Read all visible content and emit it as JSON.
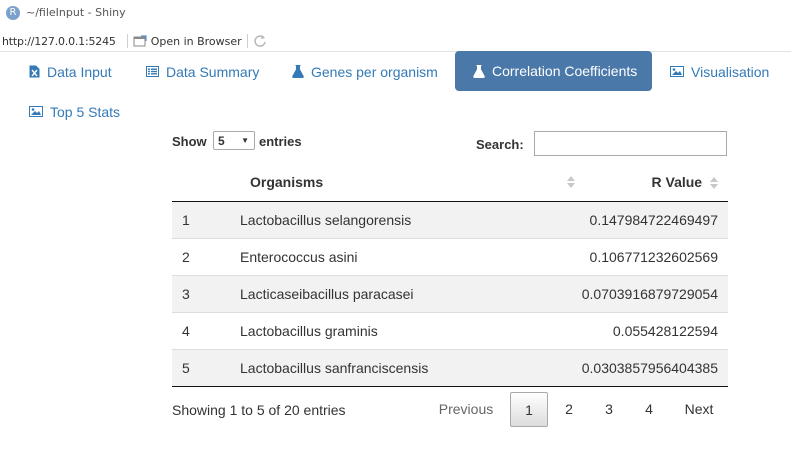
{
  "window": {
    "title": "~/fileInput - Shiny",
    "app_icon": "R"
  },
  "toolbar": {
    "url": "http://127.0.0.1:5245",
    "open_browser_label": "Open in Browser"
  },
  "tabs": [
    {
      "label": "Data Input",
      "icon": "file-excel-icon",
      "active": false
    },
    {
      "label": "Data Summary",
      "icon": "list-alt-icon",
      "active": false
    },
    {
      "label": "Genes per organism",
      "icon": "flask-icon",
      "active": false
    },
    {
      "label": "Correlation Coefficients",
      "icon": "flask-icon",
      "active": true
    },
    {
      "label": "Visualisation",
      "icon": "picture-icon",
      "active": false
    },
    {
      "label": "Top 5 Stats",
      "icon": "picture-icon",
      "active": false
    }
  ],
  "datatable": {
    "length_label_pre": "Show",
    "length_value": "5",
    "length_label_post": "entries",
    "search_label": "Search:",
    "search_value": "",
    "columns": [
      "",
      "Organisms",
      "R Value"
    ],
    "rows": [
      {
        "index": "1",
        "organism": "Lactobacillus selangorensis",
        "r_value": "0.147984722469497"
      },
      {
        "index": "2",
        "organism": "Enterococcus asini",
        "r_value": "0.106771232602569"
      },
      {
        "index": "3",
        "organism": "Lacticaseibacillus paracasei",
        "r_value": "0.0703916879729054"
      },
      {
        "index": "4",
        "organism": "Lactobacillus graminis",
        "r_value": "0.055428122594"
      },
      {
        "index": "5",
        "organism": "Lactobacillus sanfranciscensis",
        "r_value": "0.0303857956404385"
      }
    ],
    "info": "Showing 1 to 5 of 20 entries",
    "pagination": {
      "previous": "Previous",
      "pages": [
        "1",
        "2",
        "3",
        "4"
      ],
      "current": "1",
      "next": "Next"
    }
  },
  "colors": {
    "accent": "#337ab7",
    "active_tab": "#4a78a8"
  }
}
